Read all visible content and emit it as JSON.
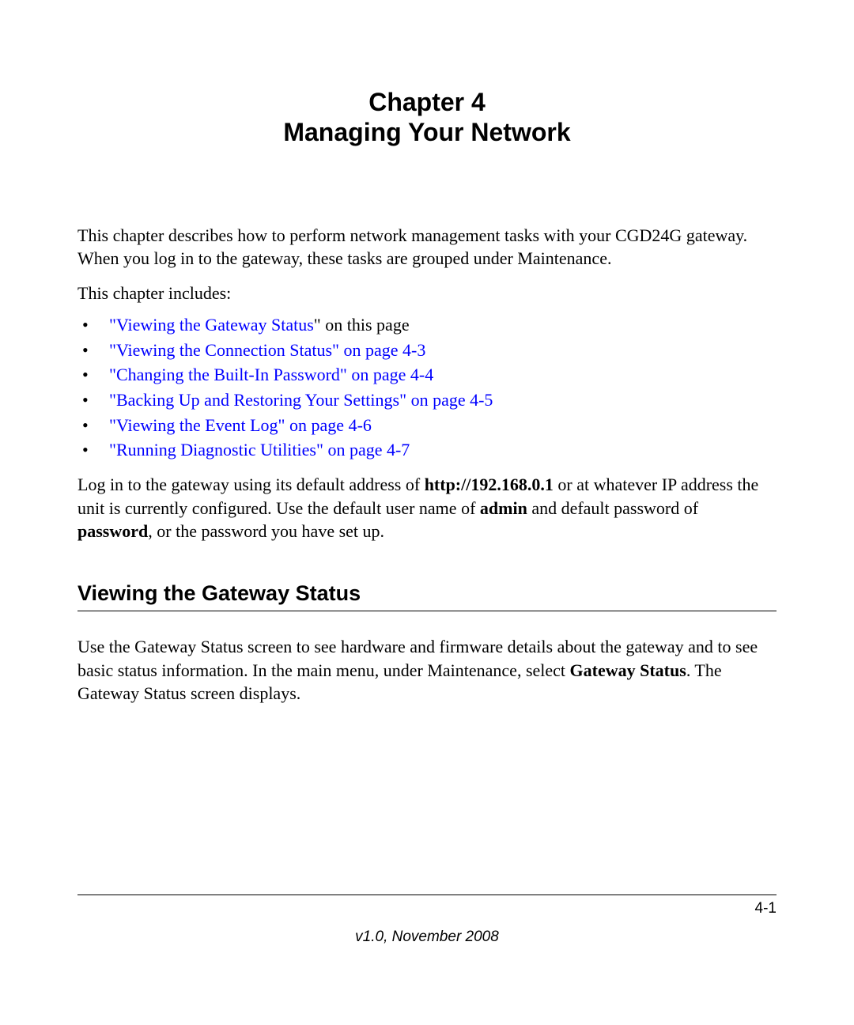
{
  "header": {
    "chapter_number": "Chapter 4",
    "chapter_title": "Managing Your Network"
  },
  "intro": "This chapter describes how to perform network management tasks with your CGD24G gateway. When you log in to the gateway, these tasks are grouped under Maintenance.",
  "includes_label": "This chapter includes:",
  "toc": [
    {
      "link": "\"Viewing the Gateway Status",
      "suffix": "\" on this page"
    },
    {
      "link": "\"Viewing the Connection Status\" on page 4-3",
      "suffix": ""
    },
    {
      "link": "\"Changing the Built-In Password\" on page 4-4",
      "suffix": ""
    },
    {
      "link": "\"Backing Up and Restoring Your Settings\" on page 4-5",
      "suffix": ""
    },
    {
      "link": "\"Viewing the Event Log\" on page 4-6",
      "suffix": ""
    },
    {
      "link": "\"Running Diagnostic Utilities\" on page 4-7",
      "suffix": ""
    }
  ],
  "login": {
    "pre1": "Log in to the gateway using its default address of ",
    "bold1": "http://192.168.0.1",
    "mid1": " or at whatever IP address the unit is currently configured. Use the default user name of ",
    "bold2": "admin",
    "mid2": " and default password of ",
    "bold3": "password",
    "suffix": ", or the password you have set up."
  },
  "section": {
    "heading": "Viewing the Gateway Status",
    "para_pre": "Use the Gateway Status screen to see hardware and firmware details about the gateway and to see basic status information. In the main menu, under Maintenance, select ",
    "para_bold": "Gateway Status",
    "para_suffix": ". The Gateway Status screen displays."
  },
  "footer": {
    "page_number": "4-1",
    "version": "v1.0, November 2008"
  }
}
